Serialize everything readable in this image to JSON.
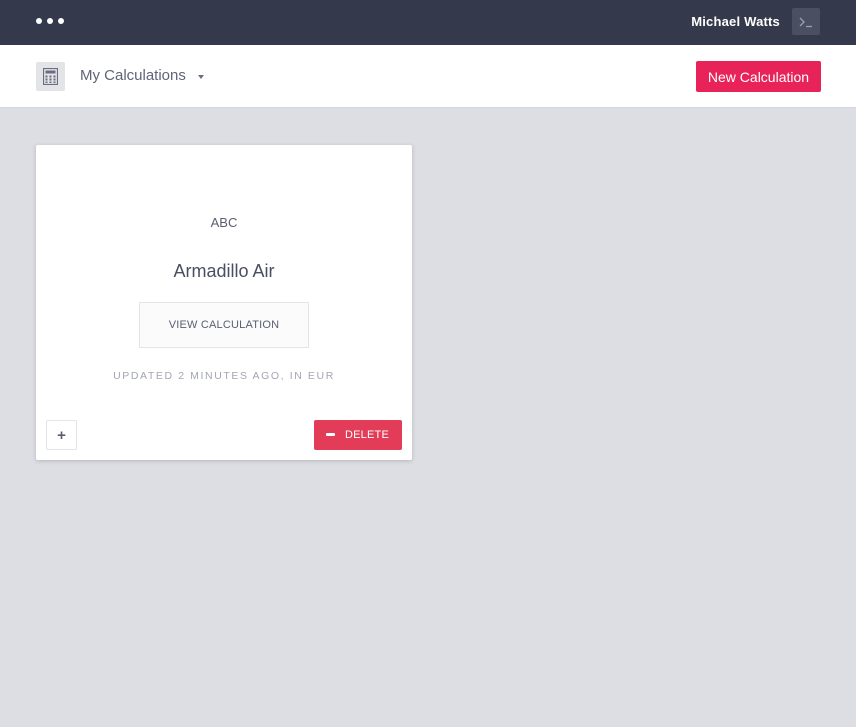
{
  "topbar": {
    "username": "Michael Watts",
    "menu_icon": "ellipsis-icon",
    "terminal_icon": "terminal-icon"
  },
  "header": {
    "icon": "calculator-icon",
    "title": "My Calculations",
    "new_button_label": "New Calculation"
  },
  "card": {
    "code": "ABC",
    "name": "Armadillo Air",
    "view_button_label": "VIEW CALCULATION",
    "updated_text": "UPDATED 2 MINUTES AGO, IN EUR",
    "add_button_label": "+",
    "delete_button_label": "DELETE"
  },
  "colors": {
    "topbar_bg": "#343a4c",
    "accent": "#e8235a",
    "delete": "#e23c58",
    "page_bg": "#dcdee3"
  }
}
